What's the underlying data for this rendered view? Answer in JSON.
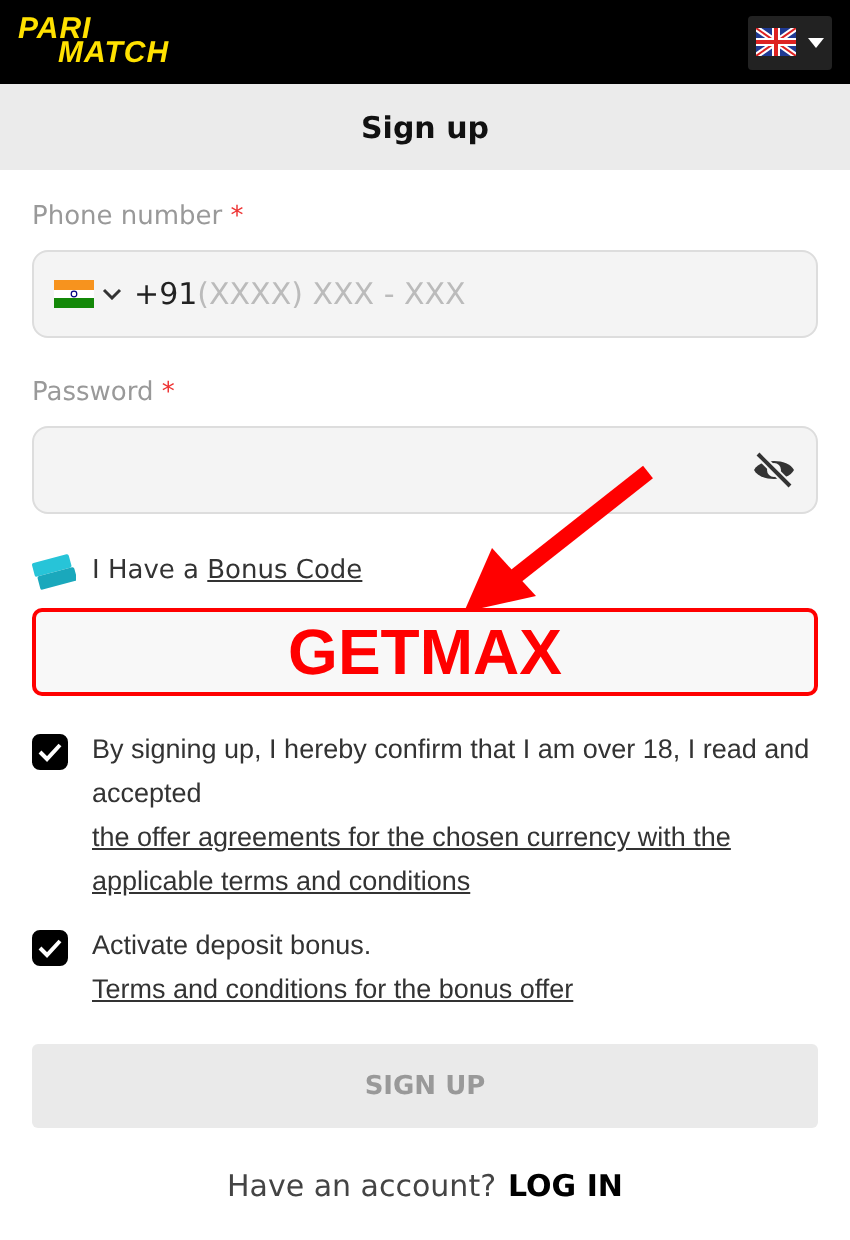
{
  "header": {
    "logo": [
      "PARI",
      "MATCH"
    ]
  },
  "title": "Sign up",
  "phone": {
    "label": "Phone number",
    "required_mark": "*",
    "prefix": "+91",
    "placeholder": "(XXXX) XXX - XXX"
  },
  "password": {
    "label": "Password",
    "required_mark": "*"
  },
  "bonus": {
    "text": "I Have a ",
    "link": "Bonus Code",
    "value": "GETMAX"
  },
  "agreements": [
    {
      "checked": true,
      "text": "By signing up, I hereby confirm that I am over 18, I read and accepted ",
      "link": "the offer agreements for the chosen currency with the applicable terms and conditions"
    },
    {
      "checked": true,
      "text": "Activate deposit bonus. ",
      "link": "Terms and conditions for the bonus offer"
    }
  ],
  "submit": {
    "label": "SIGN UP",
    "disabled": true
  },
  "login": {
    "text": "Have an account?",
    "link": "LOG IN"
  }
}
